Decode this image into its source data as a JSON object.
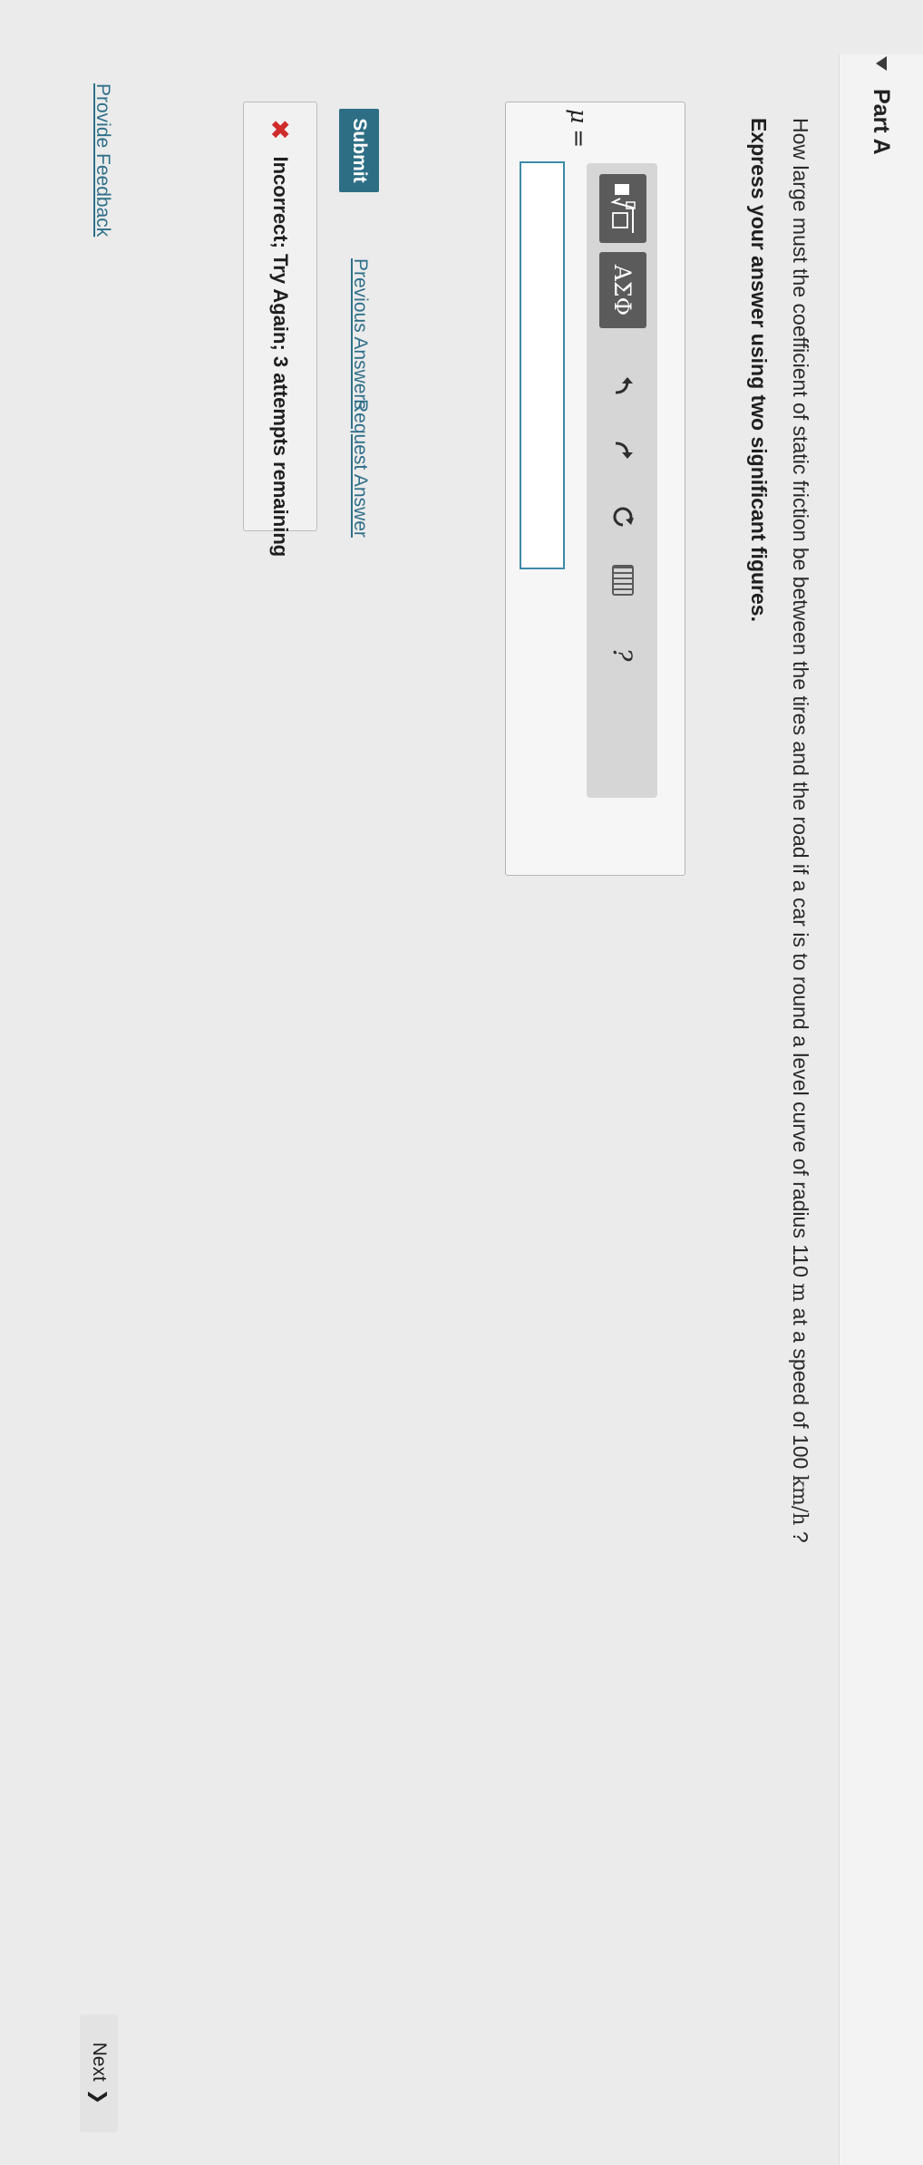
{
  "part": {
    "title": "Part A"
  },
  "question": {
    "text_before": "How large must the coefficient of static friction be between the tires and the road if a car is to round a level curve of radius 110 ",
    "radius_unit": "m",
    "text_middle": " at a speed of 100 ",
    "speed_unit": "km/h",
    "text_after": " ?",
    "instruction": "Express your answer using two significant figures."
  },
  "toolbar": {
    "templates_icon": "templates-icon",
    "greek_label": "ΑΣΦ",
    "undo_icon": "undo-icon",
    "redo_icon": "redo-icon",
    "reset_icon": "reset-icon",
    "keyboard_icon": "keyboard-icon",
    "help_label": "?"
  },
  "answer": {
    "variable_label": "μ",
    "equals": "=",
    "input_value": ""
  },
  "actions": {
    "submit_label": "Submit",
    "previous_answers_label": "Previous Answers",
    "request_answer_label": "Request Answer"
  },
  "feedback": {
    "status_icon": "x-icon",
    "status_color": "#d02c2c",
    "message": "Incorrect; Try Again; 3 attempts remaining"
  },
  "footer": {
    "provide_feedback_label": "Provide Feedback",
    "next_label": "Next"
  },
  "colors": {
    "accent": "#2d6e85",
    "link": "#2f6f8a"
  }
}
